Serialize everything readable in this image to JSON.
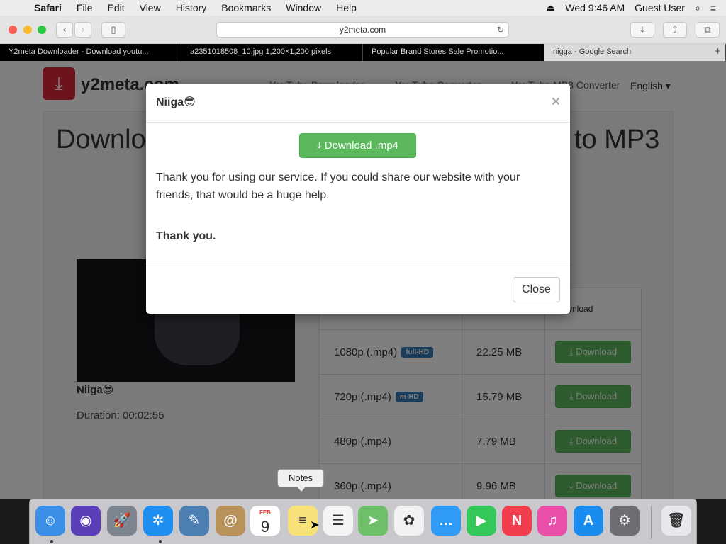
{
  "menubar": {
    "apple": "",
    "items": [
      "Safari",
      "File",
      "Edit",
      "View",
      "History",
      "Bookmarks",
      "Window",
      "Help"
    ],
    "eject": "⏏",
    "clock": "Wed 9:46 AM",
    "user": "Guest User",
    "search": "⌕",
    "list": "≡"
  },
  "toolbar": {
    "url": "y2meta.com",
    "back": "‹",
    "forward": "›",
    "sidebar": "▯",
    "reload": "↻",
    "download": "⤓",
    "share": "⇧",
    "tabs": "⧉"
  },
  "tabs": [
    "Y2meta Downloader - Download youtu...",
    "a2351018508_10.jpg 1,200×1,200 pixels",
    "Popular Brand Stores Sale Promotio...",
    "nigga - Google Search"
  ],
  "tab_plus": "+",
  "site": {
    "logo_glyph": "⤓",
    "logo_text": "y2meta.com",
    "nav": [
      "YouTube Downloader",
      "YouTube Converter",
      "YouTube MP3 Converter"
    ],
    "language": "English ▾",
    "heading_left": "Downlo",
    "heading_right": "to MP3",
    "video_title": "Niiga😎",
    "duration": "Duration: 00:02:55",
    "table_head": [
      "",
      "",
      "Download"
    ],
    "rows": [
      {
        "quality": "1080p (.mp4)",
        "badge": "full-HD",
        "size": "22.25 MB",
        "btn": "⤓ Download"
      },
      {
        "quality": "720p (.mp4)",
        "badge": "m-HD",
        "size": "15.79 MB",
        "btn": "⤓ Download"
      },
      {
        "quality": "480p (.mp4)",
        "badge": "",
        "size": "7.79 MB",
        "btn": "⤓ Download"
      },
      {
        "quality": "360p (.mp4)",
        "badge": "",
        "size": "9.96 MB",
        "btn": "⤓ Download"
      }
    ]
  },
  "modal": {
    "title": "Niiga😎",
    "close_x": "×",
    "download_label": "⤓  Download .mp4",
    "message": "Thank you for using our service. If you could share our website with your friends, that would be a huge help.",
    "thanks": "Thank you.",
    "close_label": "Close"
  },
  "dock": {
    "tooltip": "Notes",
    "calendar_month": "FEB",
    "calendar_day": "9",
    "icons": [
      {
        "name": "finder-icon",
        "glyph": "☺",
        "color": "#3b8fe6"
      },
      {
        "name": "siri-icon",
        "glyph": "◉",
        "color": "#5a3fb8"
      },
      {
        "name": "launchpad-icon",
        "glyph": "🚀",
        "color": "#7d8590"
      },
      {
        "name": "safari-icon",
        "glyph": "✲",
        "color": "#1f8ef1"
      },
      {
        "name": "preview-icon",
        "glyph": "✎",
        "color": "#4d7fb3"
      },
      {
        "name": "contacts-icon",
        "glyph": "@",
        "color": "#b8925a"
      },
      {
        "name": "calendar-icon",
        "glyph": "",
        "color": "#ffffff"
      },
      {
        "name": "notes-icon",
        "glyph": "≡",
        "color": "#f7e27a"
      },
      {
        "name": "reminders-icon",
        "glyph": "☰",
        "color": "#f4f4f4"
      },
      {
        "name": "maps-icon",
        "glyph": "➤",
        "color": "#6fbf6a"
      },
      {
        "name": "photos-icon",
        "glyph": "✿",
        "color": "#f2f2f2"
      },
      {
        "name": "messages-icon",
        "glyph": "…",
        "color": "#2f9bf7"
      },
      {
        "name": "facetime-icon",
        "glyph": "▶",
        "color": "#34c759"
      },
      {
        "name": "news-icon",
        "glyph": "N",
        "color": "#f23d4f"
      },
      {
        "name": "itunes-icon",
        "glyph": "♫",
        "color": "#e94ea8"
      },
      {
        "name": "appstore-icon",
        "glyph": "A",
        "color": "#1a8cf0"
      },
      {
        "name": "system-preferences-icon",
        "glyph": "⚙",
        "color": "#6d6d73"
      },
      {
        "name": "trash-icon",
        "glyph": "🗑",
        "color": "#e8e8ec"
      }
    ]
  }
}
